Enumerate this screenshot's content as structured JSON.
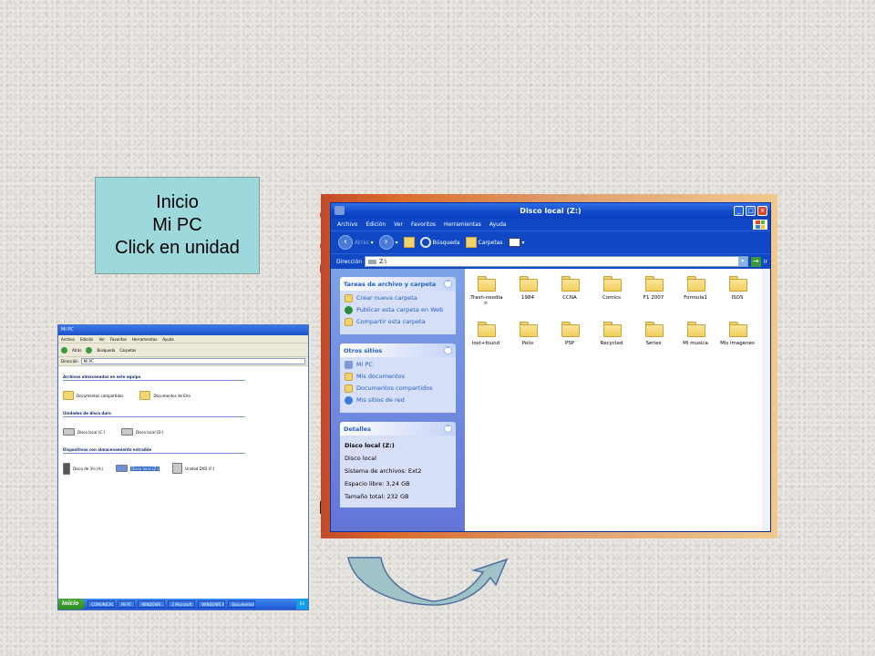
{
  "instruction": {
    "line1": "Inicio",
    "line2": "Mi PC",
    "line3": "Click  en unidad"
  },
  "mypc_window": {
    "title": "Mi PC",
    "menu": [
      "Archivo",
      "Edición",
      "Ver",
      "Favoritos",
      "Herramientas",
      "Ayuda"
    ],
    "toolbar": [
      "Atrás",
      "Búsqueda",
      "Carpetas"
    ],
    "address_label": "Dirección",
    "address_value": "Mi PC",
    "sections": [
      {
        "title": "Archivos almacenados en este equipo",
        "items": [
          "Documentos compartidos",
          "Documentos de Elro"
        ]
      },
      {
        "title": "Unidades de disco duro",
        "items": [
          "Disco local (C:)",
          "Disco local (D:)"
        ]
      },
      {
        "title": "Dispositivos con almacenamiento extraíble",
        "items": [
          "Disco de 3½ (A:)",
          "Disco local (Z:)",
          "Unidad DVD (F:)"
        ]
      }
    ],
    "taskbar": {
      "start": "Inicio",
      "tasks": [
        "COMUNICAC...",
        "Mi PC",
        "WINDOWS ...",
        "2 Microsoft ...",
        "WINDOWS X...",
        "Documento1 ..."
      ],
      "clock": "ES"
    }
  },
  "explorer": {
    "title": "Disco local (Z:)",
    "menu": [
      "Archivo",
      "Edición",
      "Ver",
      "Favoritos",
      "Herramientas",
      "Ayuda"
    ],
    "toolbar": {
      "back": "Atrás",
      "search": "Búsqueda",
      "folders": "Carpetas"
    },
    "address": {
      "label": "Dirección",
      "value": "Z:\\",
      "go": "Ir"
    },
    "tasks_panel": {
      "title": "Tareas de archivo y carpeta",
      "links": [
        "Crear nueva carpeta",
        "Publicar esta carpeta en Web",
        "Compartir esta carpeta"
      ]
    },
    "places_panel": {
      "title": "Otros sitios",
      "links": [
        "Mi PC",
        "Mis documentos",
        "Documentos compartidos",
        "Mis sitios de red"
      ]
    },
    "details_panel": {
      "title": "Detalles",
      "name": "Disco local (Z:)",
      "type": "Disco local",
      "filesystem": "Sistema de archivos: Ext2",
      "free": "Espacio libre: 3,24 GB",
      "total": "Tamaño total: 232 GB"
    },
    "folders": [
      ".Trash-neodia n",
      "1984",
      "CCNA",
      "Comics",
      "F1 2007",
      "Formula1",
      "ISOS",
      "lost+found",
      "Pelis",
      "PSP",
      "Recycled",
      "Series",
      "Mi musica",
      "Mis imagenes"
    ]
  },
  "colors": {
    "instruction_bg": "#9dd8dd",
    "xp_blue": "#0a3fbf",
    "arrow_fill": "#9fc3c6",
    "arrow_stroke": "#4f6fa3"
  }
}
